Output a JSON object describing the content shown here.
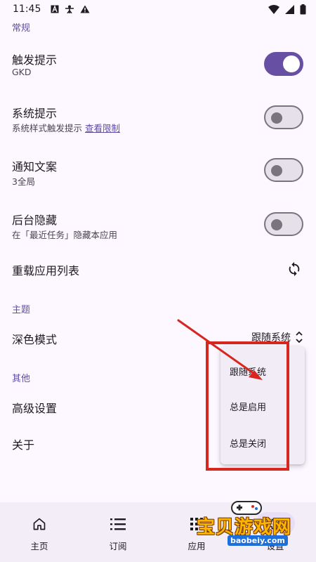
{
  "status_bar": {
    "time": "11:45"
  },
  "sections": {
    "general": "常规",
    "theme": "主题",
    "other": "其他"
  },
  "settings": {
    "trigger_tip": {
      "title": "触发提示",
      "subtitle": "GKD",
      "enabled": true
    },
    "system_tip": {
      "title": "系统提示",
      "subtitle": "系统样式触发提示",
      "link": "查看限制",
      "enabled": false
    },
    "notify_text": {
      "title": "通知文案",
      "subtitle": "3全局",
      "enabled": false
    },
    "hide_background": {
      "title": "后台隐藏",
      "subtitle": "在「最近任务」隐藏本应用",
      "enabled": false
    },
    "reload_apps": {
      "title": "重载应用列表"
    },
    "dark_mode": {
      "title": "深色模式",
      "value": "跟随系统"
    },
    "advanced": {
      "title": "高级设置"
    },
    "about": {
      "title": "关于"
    }
  },
  "dark_mode_menu": {
    "options": [
      "跟随系统",
      "总是启用",
      "总是关闭"
    ]
  },
  "bottom_nav": {
    "items": [
      {
        "label": "主页",
        "icon": "home-icon"
      },
      {
        "label": "订阅",
        "icon": "list-icon"
      },
      {
        "label": "应用",
        "icon": "apps-icon"
      },
      {
        "label": "设置",
        "icon": "settings-icon"
      }
    ]
  },
  "watermark": {
    "title": "宝贝游戏网",
    "url": "baobeiy.com"
  },
  "colors": {
    "accent": "#6750a4",
    "section_title": "#5e4fa3",
    "background": "#fdf7ff",
    "annotation": "#d8261f"
  }
}
